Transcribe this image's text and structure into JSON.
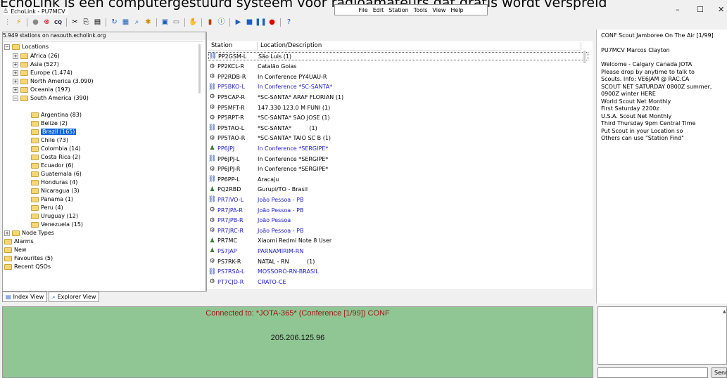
{
  "banner": "EchoLink is een computergestuurd systeem voor radioamateurs dat gratis wordt verspreid",
  "window": {
    "title": "EchoLink - PU7MCV",
    "min": "–",
    "max": "☐",
    "close": "✕"
  },
  "menu": [
    "File",
    "Edit",
    "Station",
    "Tools",
    "View",
    "Help"
  ],
  "status": {
    "count_text": "5.949 stations on nasouth.echolink.org"
  },
  "tree": {
    "root": "Locations",
    "regions": [
      {
        "label": "Africa (26)"
      },
      {
        "label": "Asia (527)"
      },
      {
        "label": "Europe (1.474)"
      },
      {
        "label": "North America (3.090)"
      },
      {
        "label": "Oceania (197)"
      },
      {
        "label": "South America (390)"
      }
    ],
    "countries": [
      "Argentina (83)",
      "Belize (2)",
      "Brazil (165)",
      "Chile (73)",
      "Colombia (14)",
      "Costa Rica (2)",
      "Ecuador (6)",
      "Guatemala (6)",
      "Honduras (4)",
      "Nicaragua (3)",
      "Panama (1)",
      "Peru (4)",
      "Uruguay (12)",
      "Venezuela (15)"
    ],
    "others": [
      "Node Types",
      "Alarms",
      "New",
      "Favourites (5)",
      "Recent QSOs"
    ]
  },
  "tabs": {
    "index": "Index View",
    "explorer": "Explorer View"
  },
  "columns": {
    "station": "Station",
    "location": "Location/Description"
  },
  "stations": [
    {
      "call": "PP2GSM-L",
      "desc": "São Luis (1)",
      "blue": false,
      "icon": "link"
    },
    {
      "call": "PP2KCL-R",
      "desc": "Catalão Goias",
      "blue": false,
      "icon": "repeater"
    },
    {
      "call": "PP2RDB-R",
      "desc": "In Conference PY4UAU-R",
      "blue": false,
      "icon": "repeater"
    },
    {
      "call": "PP5BKO-L",
      "desc": "In Conference *SC-SANTA*",
      "blue": true,
      "icon": "link"
    },
    {
      "call": "PP5CAP-R",
      "desc": "*SC-SANTA* ARAF FLORIAN (1)",
      "blue": false,
      "icon": "repeater"
    },
    {
      "call": "PP5MFT-R",
      "desc": "147.330 123.0 M FUNI (1)",
      "blue": false,
      "icon": "repeater"
    },
    {
      "call": "PP5RPT-R",
      "desc": "*SC-SANTA* SAO JOSE (1)",
      "blue": false,
      "icon": "repeater"
    },
    {
      "call": "PP5TAO-L",
      "desc": "*SC-SANTA*          (1)",
      "blue": false,
      "icon": "link"
    },
    {
      "call": "PP5TAO-R",
      "desc": "*SC-SANTA* TAIO SC B (1)",
      "blue": false,
      "icon": "repeater"
    },
    {
      "call": "PP6JPJ",
      "desc": "In Conference *SERGIPE*",
      "blue": true,
      "icon": "user"
    },
    {
      "call": "PP6JPJ-L",
      "desc": "In Conference *SERGIPE*",
      "blue": false,
      "icon": "link"
    },
    {
      "call": "PP6JPJ-R",
      "desc": "In Conference *SERGIPE*",
      "blue": false,
      "icon": "repeater"
    },
    {
      "call": "PP6PP-L",
      "desc": "Aracaju",
      "blue": false,
      "icon": "link"
    },
    {
      "call": "PQ2RBD",
      "desc": "Gurupi/TO - Brasil",
      "blue": false,
      "icon": "user"
    },
    {
      "call": "PR7IVO-L",
      "desc": "João Pessoa - PB",
      "blue": true,
      "icon": "link"
    },
    {
      "call": "PR7JPA-R",
      "desc": "João Pessoa - PB",
      "blue": true,
      "icon": "repeater"
    },
    {
      "call": "PR7JPB-R",
      "desc": "João Pessoa",
      "blue": true,
      "icon": "repeater"
    },
    {
      "call": "PR7JRC-R",
      "desc": "João Pessoa - PB",
      "blue": true,
      "icon": "repeater"
    },
    {
      "call": "PR7MC",
      "desc": "Xiaomi Redmi Note 8 User",
      "blue": false,
      "icon": "user"
    },
    {
      "call": "PS7JAP",
      "desc": "PARNAMIRIM-RN",
      "blue": true,
      "icon": "user"
    },
    {
      "call": "PS7RK-R",
      "desc": "NATAL - RN          (1)",
      "blue": false,
      "icon": "repeater"
    },
    {
      "call": "PS7RSA-L",
      "desc": "MOSSORÓ-RN-BRASIL",
      "blue": true,
      "icon": "link"
    },
    {
      "call": "PT7CJD-R",
      "desc": "CRATO-CE",
      "blue": true,
      "icon": "repeater"
    }
  ],
  "info": [
    "CONF Scout Jamboree On The Air [1/99]",
    "",
    "PU7MCV Marcos Clayton",
    "",
    "Welcome - Calgary Canada JOTA",
    "Please drop by anytime to talk to",
    "Scouts. Info: VE6JAM @ RAC.CA",
    "SCOUT NET SATURDAY 0800Z summer,",
    "0900Z winter HERE",
    "World Scout Net Monthly",
    "First Saturday 2200z",
    "U.S.A. Scout Net Monthly",
    "Third Thursday 9pm Central Time",
    "Put Scout in your Location so",
    "Others can use \"Station Find\""
  ],
  "connection": {
    "line": "Connected to:  *JOTA-365* (Conference  [1/99]) CONF",
    "ip": "205.206.125.96"
  },
  "chat": {
    "send_label": "Send"
  },
  "colors": {
    "conn_bg": "#8fc693",
    "conn_text": "#9a1a1a",
    "blue_station": "#2020c8",
    "selection": "#0a64d8"
  }
}
